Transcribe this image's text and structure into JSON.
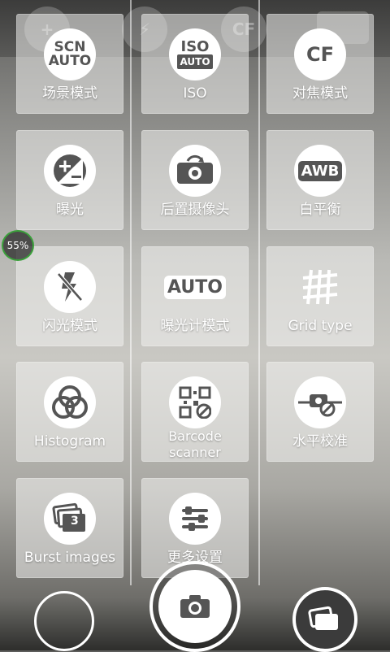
{
  "status": {
    "zoom_percent": "55%"
  },
  "toolbar": {
    "ghost_icons": [
      "add-icon",
      "no-flash-icon",
      "cf-icon",
      "battery-icon"
    ],
    "cf_text": "CF"
  },
  "tiles": [
    {
      "label": "场景模式",
      "icon": "scene-auto-icon",
      "icon_text1": "SCN",
      "icon_text2": "AUTO"
    },
    {
      "label": "ISO",
      "icon": "iso-auto-icon",
      "icon_text1": "ISO",
      "icon_text2": "AUTO"
    },
    {
      "label": "对焦模式",
      "icon": "cf-focus-icon",
      "icon_text1": "CF"
    },
    {
      "label": "曝光",
      "icon": "exposure-icon"
    },
    {
      "label": "后置摄像头",
      "icon": "switch-camera-icon"
    },
    {
      "label": "白平衡",
      "icon": "awb-icon",
      "icon_text1": "AWB"
    },
    {
      "label": "闪光模式",
      "icon": "flash-off-icon"
    },
    {
      "label": "曝光计模式",
      "icon": "metering-auto-icon",
      "icon_text1": "AUTO"
    },
    {
      "label": "Grid type",
      "icon": "grid-icon"
    },
    {
      "label": "Histogram",
      "icon": "histogram-icon"
    },
    {
      "label": "Barcode scanner",
      "icon": "qr-code-icon"
    },
    {
      "label": "水平校准",
      "icon": "level-icon"
    },
    {
      "label": "Burst images",
      "icon": "burst-icon",
      "icon_text1": "3"
    },
    {
      "label": "更多设置",
      "icon": "sliders-icon"
    }
  ],
  "colors": {
    "tile_bg": "#f0f0ee",
    "icon_fg": "#555555",
    "zoom_ring": "#3aa03a"
  }
}
